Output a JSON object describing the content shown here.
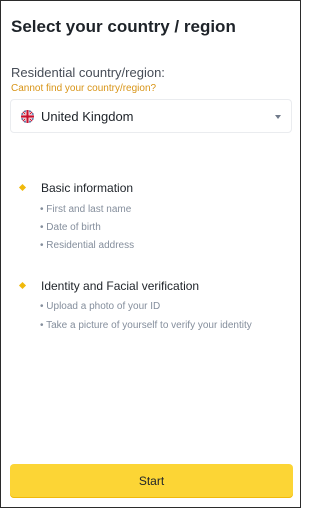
{
  "header": {
    "title": "Select your country / region"
  },
  "residence": {
    "label": "Residential country/region:",
    "help_link": "Cannot find your country/region?",
    "selected_country": "United Kingdom",
    "flag_icon": "uk-flag-icon",
    "dropdown_icon": "caret-down-icon"
  },
  "steps": [
    {
      "title": "Basic information",
      "items": [
        "First and last name",
        "Date of birth",
        "Residential address"
      ]
    },
    {
      "title": "Identity and Facial verification",
      "items": [
        "Upload a photo of your ID",
        "Take a picture of yourself to verify your identity"
      ]
    }
  ],
  "footer": {
    "start_label": "Start"
  },
  "colors": {
    "accent": "#f0b90b",
    "button": "#fcd535",
    "link": "#d89416",
    "text_primary": "#1e2329",
    "text_secondary": "#848e9c"
  }
}
